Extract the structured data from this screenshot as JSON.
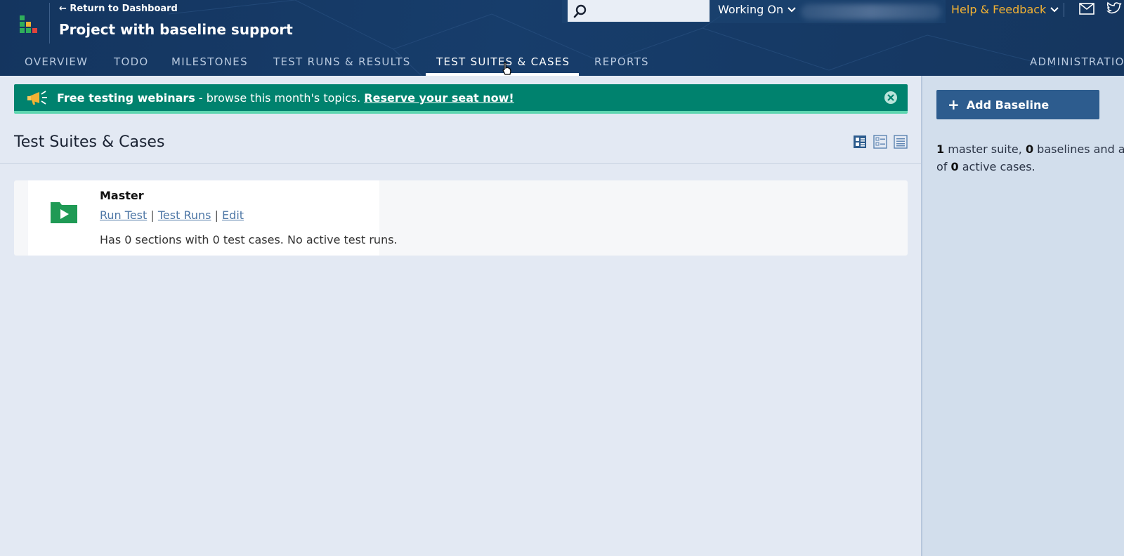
{
  "header": {
    "back_link": "← Return to Dashboard",
    "project_title": "Project with baseline support",
    "search": {
      "value": "",
      "placeholder": ""
    },
    "working_on": "Working On",
    "help_feedback": "Help & Feedback",
    "icons": [
      "search-icon",
      "chevron-down-icon",
      "mail-icon",
      "twitter-icon"
    ]
  },
  "nav": {
    "tabs": [
      {
        "label": "OVERVIEW",
        "active": false
      },
      {
        "label": "TODO",
        "active": false
      },
      {
        "label": "MILESTONES",
        "active": false
      },
      {
        "label": "TEST RUNS & RESULTS",
        "active": false
      },
      {
        "label": "TEST SUITES & CASES",
        "active": true
      },
      {
        "label": "REPORTS",
        "active": false
      },
      {
        "label": "ADMINISTRATIO",
        "active": false
      }
    ]
  },
  "banner": {
    "bold": "Free testing webinars",
    "text": " - browse this month's topics. ",
    "link": "Reserve your seat now!"
  },
  "main": {
    "title": "Test Suites & Cases",
    "suite": {
      "name": "Master",
      "links": [
        "Run Test",
        "Test Runs",
        "Edit"
      ],
      "separator": "|",
      "description": "Has 0 sections with 0 test cases. No active test runs."
    }
  },
  "sidebar": {
    "add_button": "Add Baseline",
    "summary": {
      "master_count": "1",
      "t1": " master suite, ",
      "baseline_count": "0",
      "t2": " baselines and a to",
      "t3": "of ",
      "active_count": "0",
      "t4": " active cases."
    }
  },
  "colors": {
    "header_bg": "#173d6b",
    "banner_bg": "#00826e",
    "accent_yellow": "#f3b233",
    "button_bg": "#2d5c8e",
    "link": "#4e77a6",
    "folder_green": "#1f9a55"
  }
}
